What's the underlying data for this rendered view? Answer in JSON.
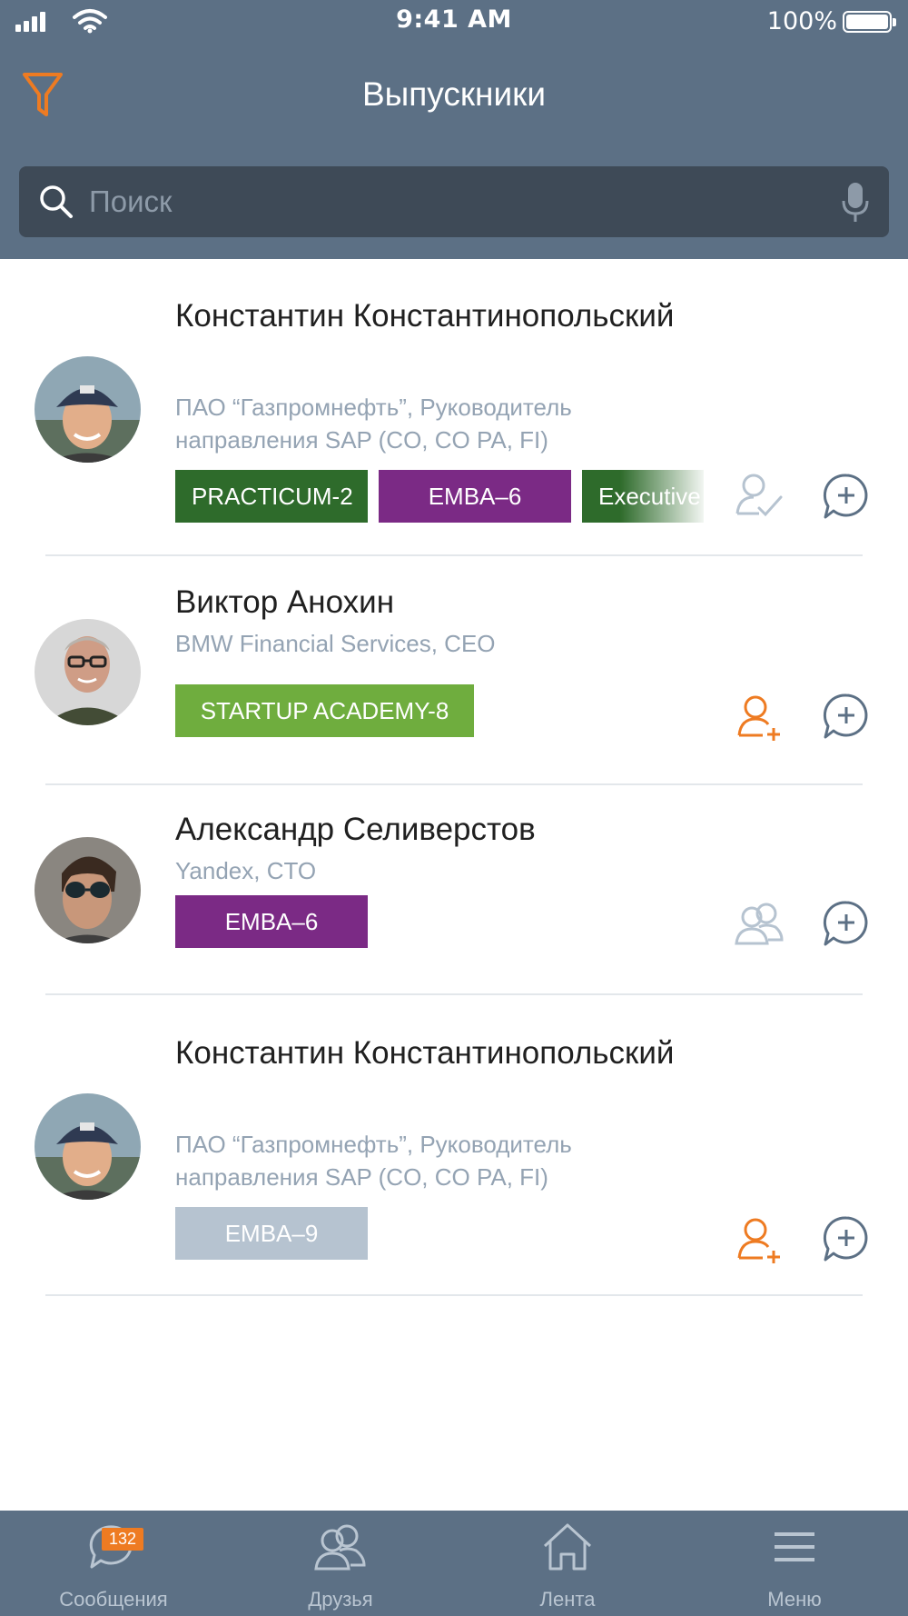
{
  "status_bar": {
    "time": "9:41 AM",
    "battery": "100%"
  },
  "header": {
    "title": "Выпускники"
  },
  "search": {
    "placeholder": "Поиск",
    "value": ""
  },
  "graduates": [
    {
      "name": "Константин Константинопольский",
      "position": "ПАО “Газпромнефть”, Руководитель направления SAP (CO, CO PA, FI)",
      "tags": [
        {
          "label": "PRACTICUM-2",
          "color": "#2e6b2b"
        },
        {
          "label": "EMBA–6",
          "color": "#7b2a85"
        },
        {
          "label": "Executive",
          "color": "#2e6b2b"
        }
      ],
      "friend_status": "request-sent-icon",
      "avatar": "young-man-cap"
    },
    {
      "name": "Виктор Анохин",
      "position": "BMW Financial Services, CEO",
      "tags": [
        {
          "label": "STARTUP ACADEMY-8",
          "color": "#6fad3e"
        }
      ],
      "friend_status": "add-friend-icon",
      "avatar": "man-glasses"
    },
    {
      "name": "Александр Селиверстов",
      "position": "Yandex, CTO",
      "tags": [
        {
          "label": "EMBA–6",
          "color": "#7b2a85"
        }
      ],
      "friend_status": "friends-icon",
      "avatar": "man-sunglasses"
    },
    {
      "name": "Константин Константинопольский",
      "position": "ПАО “Газпромнефть”, Руководитель направления SAP (CO, CO PA, FI)",
      "tags": [
        {
          "label": "EMBA–9",
          "color": "#b6c3d0"
        }
      ],
      "friend_status": "add-friend-icon",
      "avatar": "young-man-cap"
    }
  ],
  "tabbar": {
    "messages": {
      "label": "Сообщения",
      "badge": "132"
    },
    "friends": {
      "label": "Друзья"
    },
    "feed": {
      "label": "Лента"
    },
    "menu": {
      "label": "Меню"
    }
  },
  "colors": {
    "header": "#5c7085",
    "accent": "#ee7b22",
    "search_bg": "#3e4a57"
  }
}
